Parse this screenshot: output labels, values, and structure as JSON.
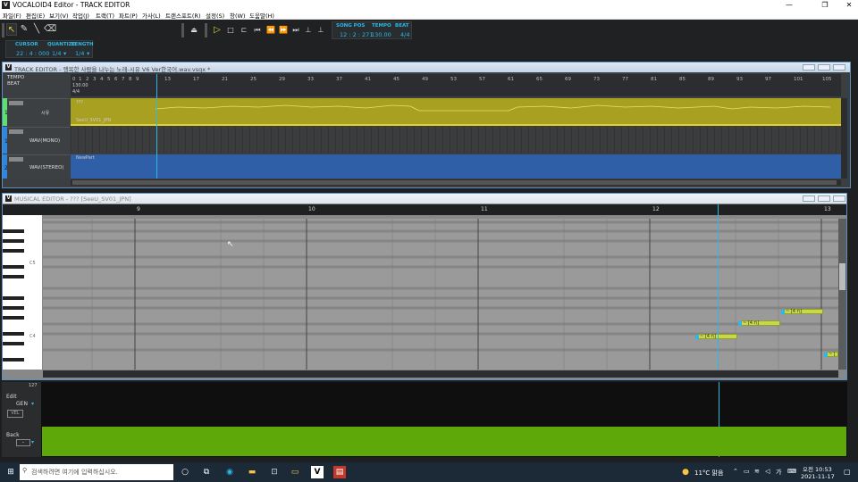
{
  "window": {
    "title": "VOCALOID4 Editor - TRACK EDITOR",
    "app_icon": "V"
  },
  "menu": [
    "파일(F)",
    "편집(E)",
    "보기(V)",
    "작업(J)",
    "트랙(T)",
    "파트(P)",
    "가사(L)",
    "트랜스포트(R)",
    "설정(S)",
    "창(W)",
    "도움말(H)"
  ],
  "toolbar": {
    "cursor_label": "CURSOR",
    "cursor_value": "22 : 4 : 000",
    "quantize_label": "QUANTIZE",
    "quantize_value": "1/4",
    "length_label": "LENGTH",
    "length_value": "1/4",
    "songpos_label": "SONG POS",
    "songpos_value": "12 : 2 : 271",
    "tempo_label": "TEMPO",
    "tempo_value": "130.00",
    "beat_label": "BEAT",
    "beat_value": "4/4"
  },
  "track_editor": {
    "title": "TRACK EDITOR - 행복한 사람을 나누는 노래-시유 V6 Ver한국어.wav.vsqx *",
    "tempo_label": "TEMPO",
    "tempo_value": "130.00",
    "beat_label": "BEAT",
    "beat_value": "4/4",
    "bar_numbers": [
      "0",
      "1",
      "2",
      "3",
      "4",
      "5",
      "6",
      "7",
      "8",
      "9",
      "13",
      "17",
      "21",
      "25",
      "29",
      "33",
      "37",
      "41",
      "45",
      "49",
      "53",
      "57",
      "61",
      "65",
      "69",
      "73",
      "77",
      "81",
      "85",
      "89",
      "93",
      "97",
      "101",
      "105"
    ],
    "tracks": [
      {
        "num": "1",
        "name": "시유",
        "part_label": "???",
        "singer": "SeeU_SV01_JPN",
        "color": "#5ee070"
      },
      {
        "num": "1",
        "name": "WAV(MONO)",
        "color": "#2e86de"
      },
      {
        "num": "2",
        "name": "WAV(STEREO)",
        "part_label": "NewPart",
        "color": "#2e86de"
      }
    ]
  },
  "musical_editor": {
    "title": "MUSICAL EDITOR - ??? [SeeU_SV01_JPN]",
    "bars": [
      "9",
      "10",
      "11",
      "12",
      "13"
    ],
    "octaves": [
      "C5",
      "C4"
    ],
    "notes": [
      {
        "lyric": "~ [4 r\\]",
        "pos": 0.8
      },
      {
        "lyric": "~ [4 r\\]",
        "pos": 0.85
      },
      {
        "lyric": "~ [4 r\\]",
        "pos": 0.9
      },
      {
        "lyric": "~ [",
        "pos": 0.99
      }
    ]
  },
  "control_panel": {
    "max": "127",
    "edit_label": "Edit",
    "edit_value": "GEN",
    "vel_label": "VEL",
    "back_label": "Back",
    "back_value": "-"
  },
  "taskbar": {
    "search_placeholder": "검색하려면 여기에 입력하십시오.",
    "weather": "11°C 맑음",
    "lang": "가",
    "time": "오전 10:53",
    "date": "2021-11-17"
  },
  "colors": {
    "accent": "#2bb8e6",
    "track_part": "#a8a020",
    "velocity": "#5fa80a",
    "note": "#c9d84a"
  }
}
